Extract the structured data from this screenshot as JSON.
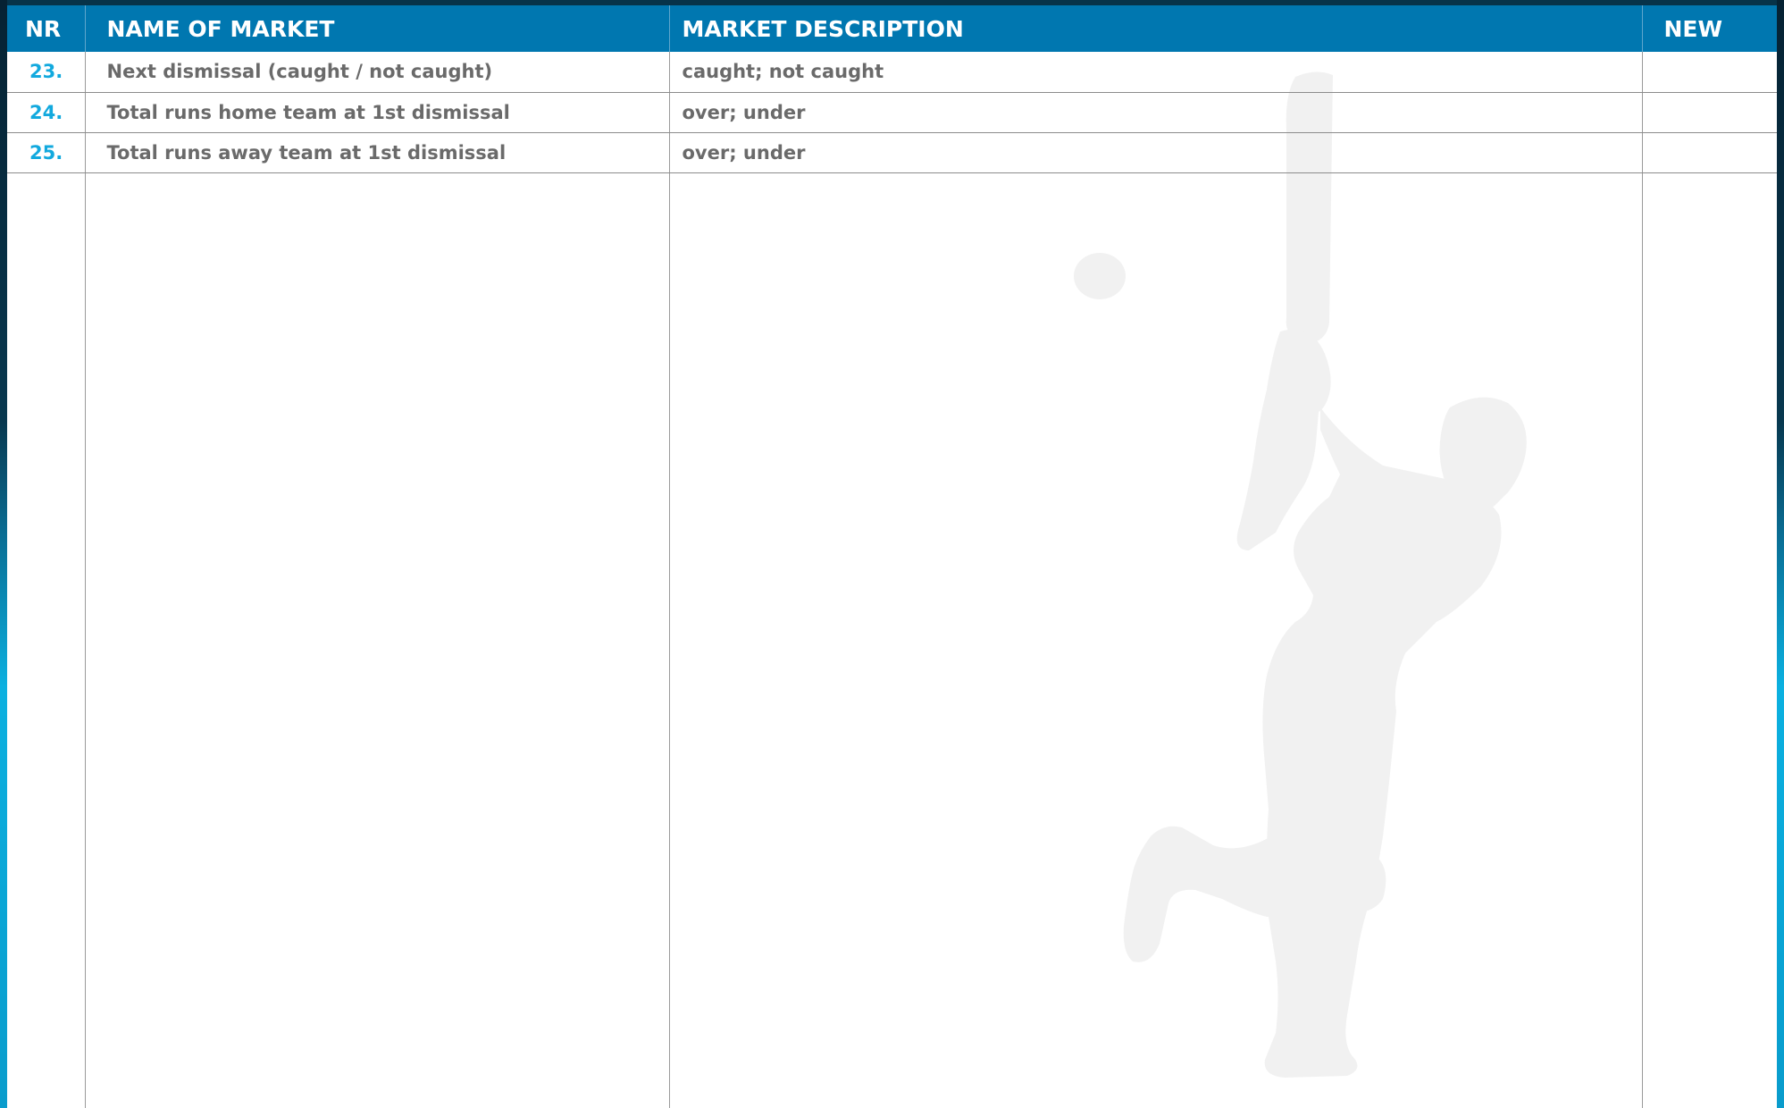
{
  "table": {
    "headers": {
      "nr": "NR",
      "name": "NAME OF MARKET",
      "description": "MARKET DESCRIPTION",
      "new": "NEW"
    },
    "rows": [
      {
        "nr": "23.",
        "name": "Next dismissal (caught / not caught)",
        "description": "caught; not caught",
        "new": ""
      },
      {
        "nr": "24.",
        "name": "Total runs home team at 1st dismissal",
        "description": "over; under",
        "new": ""
      },
      {
        "nr": "25.",
        "name": "Total runs away team at 1st dismissal",
        "description": "over; under",
        "new": ""
      }
    ]
  },
  "colors": {
    "header_bg": "#0077b0",
    "number_accent": "#12a9de",
    "body_text": "#6a6a6a",
    "watermark": "#f1f1f1"
  },
  "decor": {
    "watermark_icon": "cricket-batsman-icon",
    "ball_icon": "cricket-ball-icon"
  }
}
